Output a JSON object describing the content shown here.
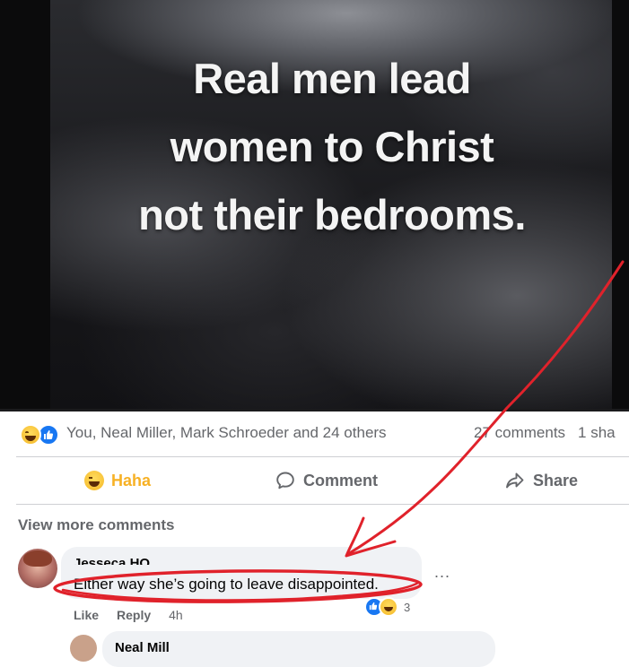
{
  "post": {
    "image_caption_lines": [
      "Real men lead",
      "women to Christ",
      "not their bedrooms."
    ]
  },
  "reactions": {
    "names": "You, Neal Miller, Mark Schroeder and 24 others",
    "comments_count": "27 comments",
    "shares": "1 sha"
  },
  "actions": {
    "haha": "Haha",
    "comment": "Comment",
    "share": "Share"
  },
  "comments": {
    "view_more": "View more comments",
    "first": {
      "author": "Jesseca HO",
      "text": "Either way she’s going to leave disappointed.",
      "reaction_count": "3",
      "like": "Like",
      "reply": "Reply",
      "time": "4h",
      "more": "..."
    },
    "second": {
      "author": "Neal Mill"
    }
  },
  "colors": {
    "annotation_red": "#e0222b",
    "facebook_blue": "#1877f2",
    "haha_yellow": "#f7b125",
    "muted_text": "#65676b"
  },
  "icons": [
    "haha-icon",
    "like-icon",
    "comment-icon",
    "share-icon"
  ]
}
